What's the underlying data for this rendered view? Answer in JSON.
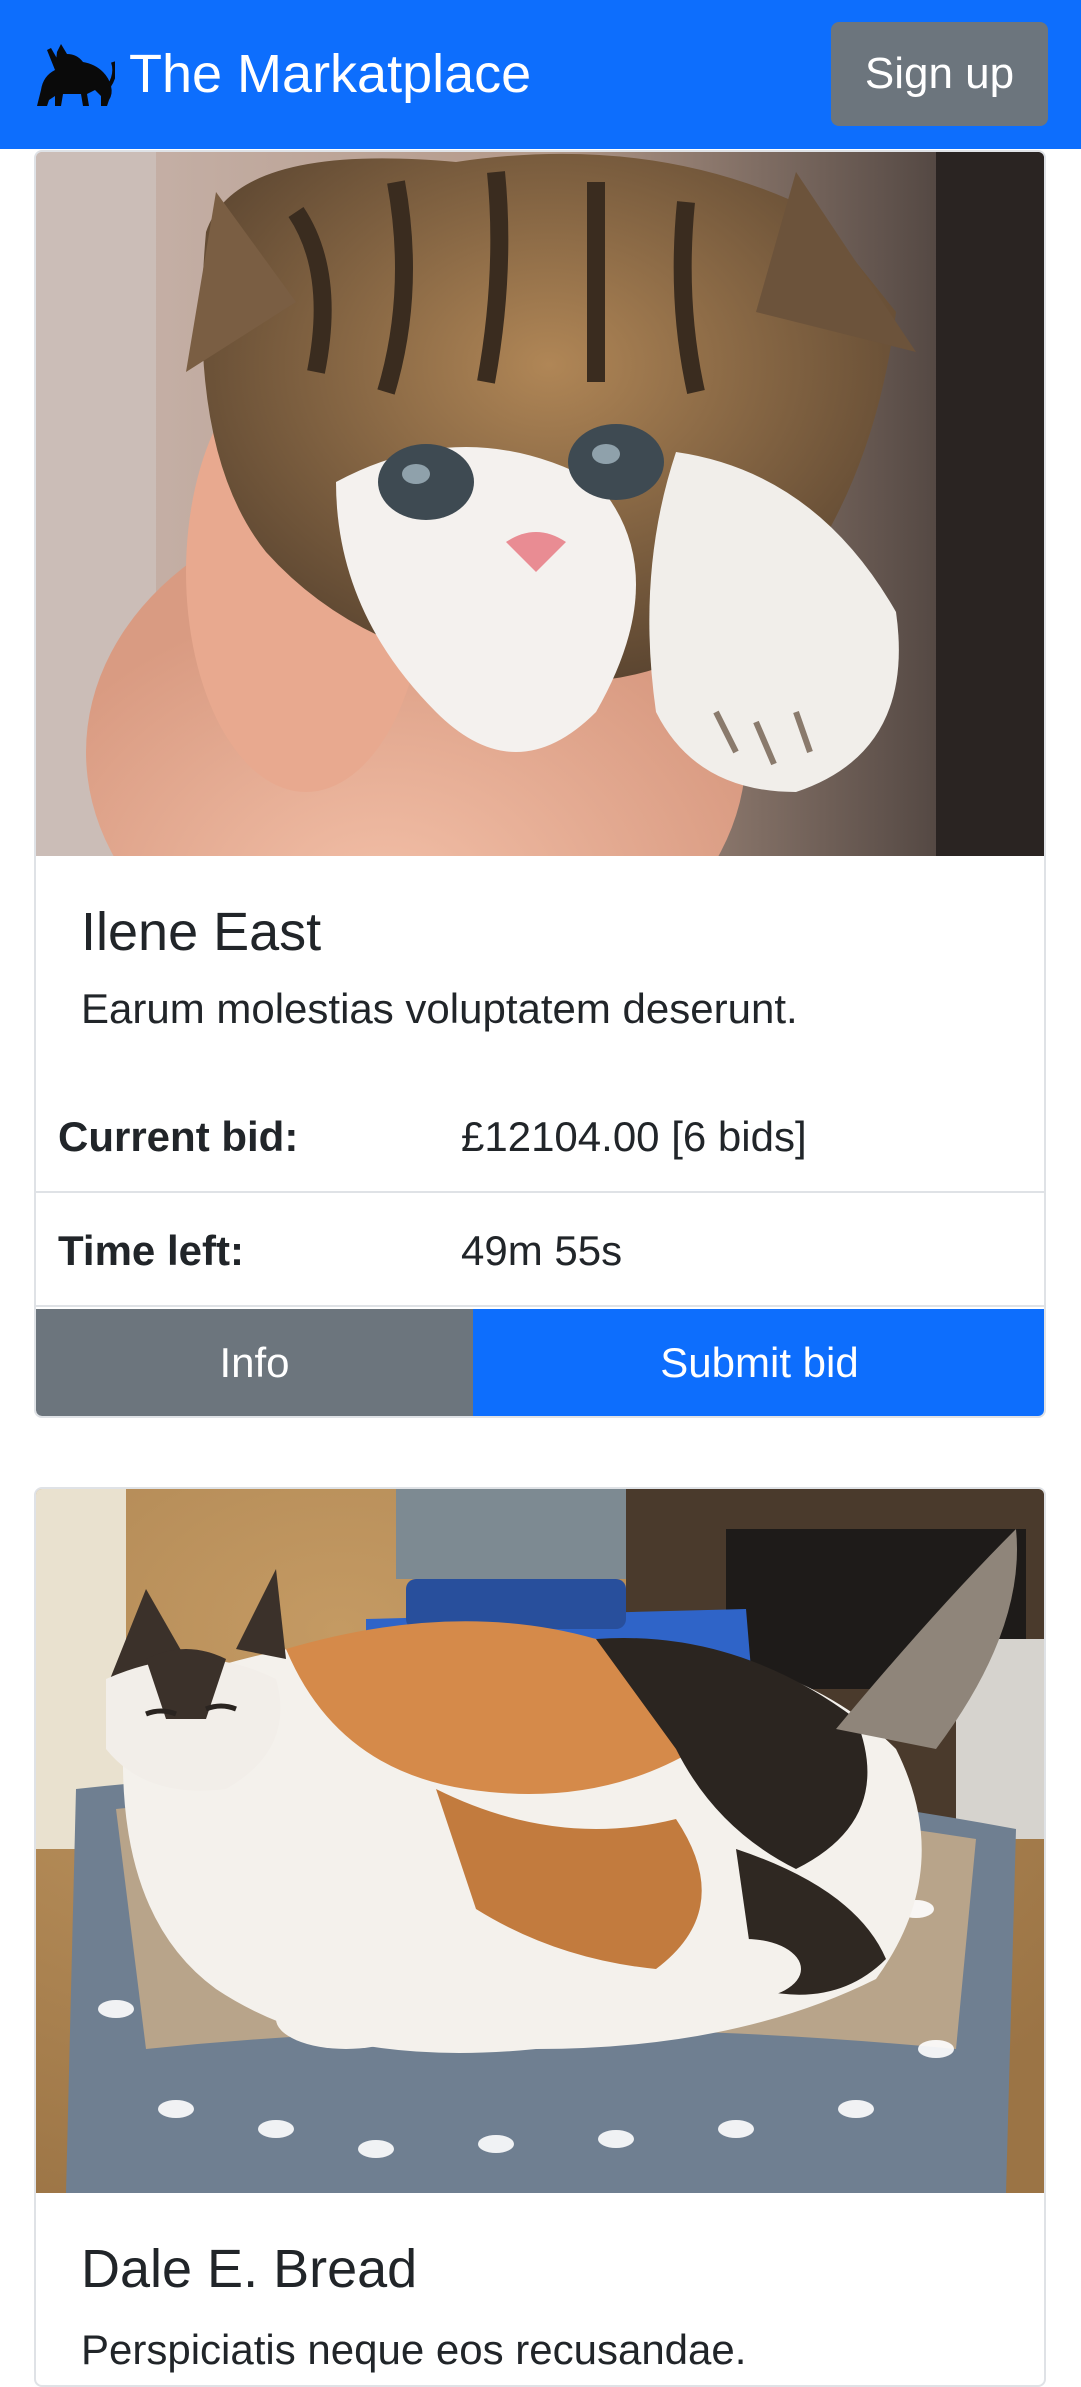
{
  "header": {
    "brand_title": "The Markatplace",
    "brand_icon": "cat-icon",
    "signup_label": "Sign up",
    "bar_color": "#0d6efd"
  },
  "listings": [
    {
      "name": "Ilene East",
      "description": "Earum molestias voluptatem deserunt.",
      "current_bid_label": "Current bid:",
      "current_bid_value": "£12104.00 [6 bids]",
      "time_left_label": "Time left:",
      "time_left_value": "49m 55s",
      "info_label": "Info",
      "submit_label": "Submit bid"
    },
    {
      "name": "Dale E. Bread",
      "description": "Perspiciatis neque eos recusandae."
    }
  ]
}
